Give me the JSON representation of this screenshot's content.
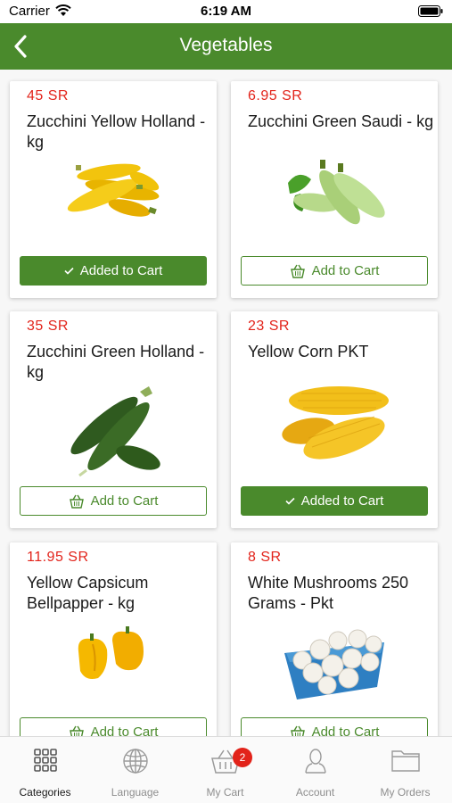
{
  "status": {
    "carrier": "Carrier",
    "time": "6:19 AM"
  },
  "nav": {
    "title": "Vegetables",
    "back_icon": "chevron-left-icon"
  },
  "colors": {
    "brand_green": "#4a8a2c",
    "price_red": "#e2231a"
  },
  "products": [
    {
      "price": "45 SR",
      "name": "Zucchini Yellow Holland - kg",
      "button": "Added to Cart",
      "in_cart": true,
      "image": "yellow-zucchini"
    },
    {
      "price": "6.95 SR",
      "name": "Zucchini Green Saudi - kg",
      "button": "Add to Cart",
      "in_cart": false,
      "image": "green-zucchini-light"
    },
    {
      "price": "35 SR",
      "name": "Zucchini Green Holland - kg",
      "button": "Add to Cart",
      "in_cart": false,
      "image": "green-zucchini-dark"
    },
    {
      "price": "23 SR",
      "name": "Yellow Corn PKT",
      "button": "Added to Cart",
      "in_cart": true,
      "image": "yellow-corn"
    },
    {
      "price": "11.95 SR",
      "name": "Yellow Capsicum Bellpapper - kg",
      "button": "Add to Cart",
      "in_cart": false,
      "image": "yellow-capsicum"
    },
    {
      "price": "8 SR",
      "name": "White Mushrooms 250 Grams - Pkt",
      "button": "Add to Cart",
      "in_cart": false,
      "image": "white-mushrooms"
    }
  ],
  "tabs": [
    {
      "label": "Categories",
      "icon": "grid-icon",
      "active": true
    },
    {
      "label": "Language",
      "icon": "globe-icon",
      "active": false
    },
    {
      "label": "My Cart",
      "icon": "basket-icon",
      "active": false,
      "badge": "2"
    },
    {
      "label": "Account",
      "icon": "user-icon",
      "active": false
    },
    {
      "label": "My Orders",
      "icon": "folder-icon",
      "active": false
    }
  ]
}
